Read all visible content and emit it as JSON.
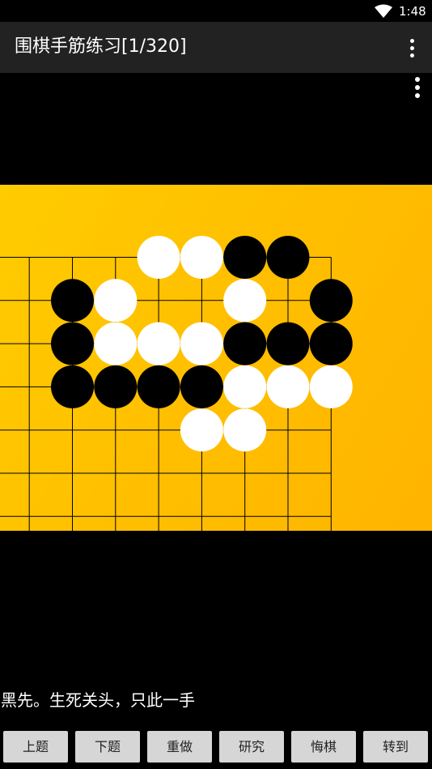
{
  "status_bar": {
    "time": "1:48",
    "wifi_icon": "wifi-icon"
  },
  "app_bar": {
    "title": "围棋手筋练习[1/320]",
    "menu_icon": "overflow-menu-icon"
  },
  "board": {
    "menu_icon": "overflow-menu-icon",
    "colors": {
      "black": "#000000",
      "white": "#ffffff",
      "board": "#ffc400",
      "line": "#000000"
    },
    "stones": [
      {
        "col": 3,
        "row": 0,
        "color": "white"
      },
      {
        "col": 4,
        "row": 0,
        "color": "white"
      },
      {
        "col": 5,
        "row": 0,
        "color": "black"
      },
      {
        "col": 6,
        "row": 0,
        "color": "black"
      },
      {
        "col": 1,
        "row": 1,
        "color": "black"
      },
      {
        "col": 2,
        "row": 1,
        "color": "white"
      },
      {
        "col": 5,
        "row": 1,
        "color": "white"
      },
      {
        "col": 7,
        "row": 1,
        "color": "black"
      },
      {
        "col": 1,
        "row": 2,
        "color": "black"
      },
      {
        "col": 2,
        "row": 2,
        "color": "white"
      },
      {
        "col": 3,
        "row": 2,
        "color": "white"
      },
      {
        "col": 4,
        "row": 2,
        "color": "white"
      },
      {
        "col": 5,
        "row": 2,
        "color": "black"
      },
      {
        "col": 6,
        "row": 2,
        "color": "black"
      },
      {
        "col": 7,
        "row": 2,
        "color": "black"
      },
      {
        "col": 1,
        "row": 3,
        "color": "black"
      },
      {
        "col": 2,
        "row": 3,
        "color": "black"
      },
      {
        "col": 3,
        "row": 3,
        "color": "black"
      },
      {
        "col": 4,
        "row": 3,
        "color": "black"
      },
      {
        "col": 5,
        "row": 3,
        "color": "white"
      },
      {
        "col": 6,
        "row": 3,
        "color": "white"
      },
      {
        "col": 7,
        "row": 3,
        "color": "white"
      },
      {
        "col": 4,
        "row": 4,
        "color": "white"
      },
      {
        "col": 5,
        "row": 4,
        "color": "white"
      }
    ]
  },
  "prompt": "黑先。生死关头，只此一手",
  "toolbar": {
    "buttons": [
      "上题",
      "下题",
      "重做",
      "研究",
      "悔棋",
      "转到"
    ]
  }
}
